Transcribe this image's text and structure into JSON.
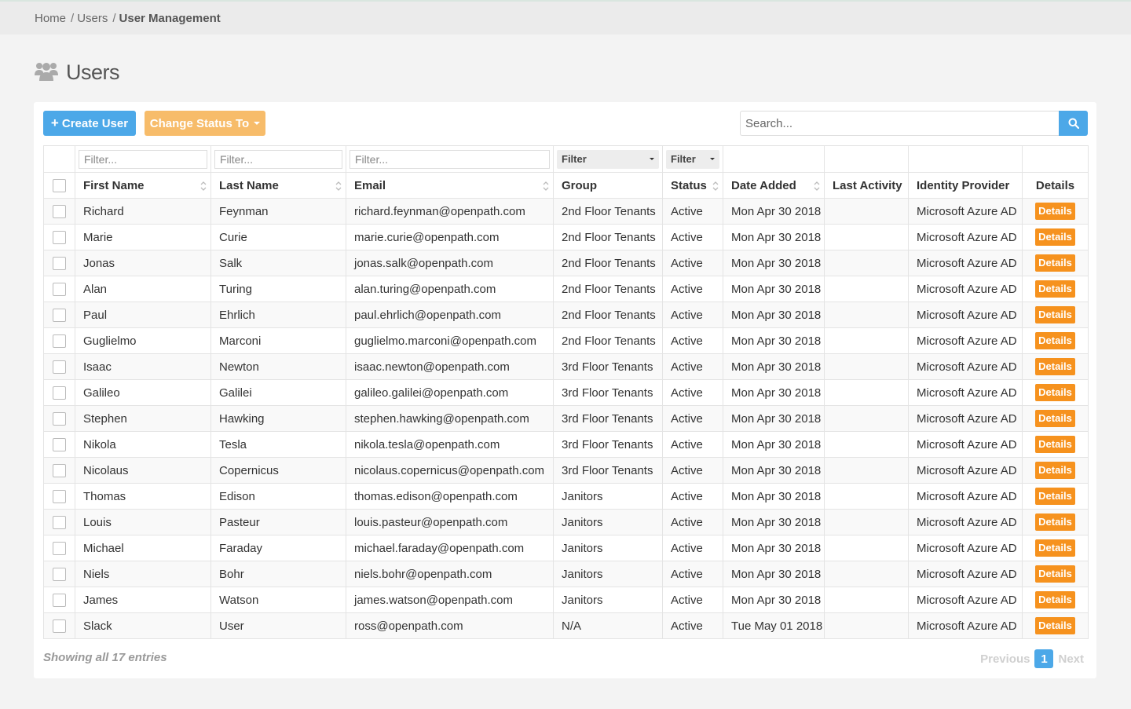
{
  "breadcrumb": {
    "home": "Home",
    "users": "Users",
    "current": "User Management"
  },
  "page": {
    "title": "Users"
  },
  "toolbar": {
    "create_label": "Create User",
    "create_icon": "+",
    "status_label": "Change Status To",
    "search_placeholder": "Search..."
  },
  "filters": {
    "text_placeholder": "Filter...",
    "select_label": "Filter"
  },
  "columns": [
    "First Name",
    "Last Name",
    "Email",
    "Group",
    "Status",
    "Date Added",
    "Last Activity",
    "Identity Provider",
    "Details"
  ],
  "details_label": "Details",
  "rows": [
    {
      "first": "Richard",
      "last": "Feynman",
      "email": "richard.feynman@openpath.com",
      "group": "2nd Floor Tenants",
      "status": "Active",
      "date": "Mon Apr 30 2018",
      "activity": "",
      "provider": "Microsoft Azure AD"
    },
    {
      "first": "Marie",
      "last": "Curie",
      "email": "marie.curie@openpath.com",
      "group": "2nd Floor Tenants",
      "status": "Active",
      "date": "Mon Apr 30 2018",
      "activity": "",
      "provider": "Microsoft Azure AD"
    },
    {
      "first": "Jonas",
      "last": "Salk",
      "email": "jonas.salk@openpath.com",
      "group": "2nd Floor Tenants",
      "status": "Active",
      "date": "Mon Apr 30 2018",
      "activity": "",
      "provider": "Microsoft Azure AD"
    },
    {
      "first": "Alan",
      "last": "Turing",
      "email": "alan.turing@openpath.com",
      "group": "2nd Floor Tenants",
      "status": "Active",
      "date": "Mon Apr 30 2018",
      "activity": "",
      "provider": "Microsoft Azure AD"
    },
    {
      "first": "Paul",
      "last": "Ehrlich",
      "email": "paul.ehrlich@openpath.com",
      "group": "2nd Floor Tenants",
      "status": "Active",
      "date": "Mon Apr 30 2018",
      "activity": "",
      "provider": "Microsoft Azure AD"
    },
    {
      "first": "Guglielmo",
      "last": "Marconi",
      "email": "guglielmo.marconi@openpath.com",
      "group": "2nd Floor Tenants",
      "status": "Active",
      "date": "Mon Apr 30 2018",
      "activity": "",
      "provider": "Microsoft Azure AD"
    },
    {
      "first": "Isaac",
      "last": "Newton",
      "email": "isaac.newton@openpath.com",
      "group": "3rd Floor Tenants",
      "status": "Active",
      "date": "Mon Apr 30 2018",
      "activity": "",
      "provider": "Microsoft Azure AD"
    },
    {
      "first": "Galileo",
      "last": "Galilei",
      "email": "galileo.galilei@openpath.com",
      "group": "3rd Floor Tenants",
      "status": "Active",
      "date": "Mon Apr 30 2018",
      "activity": "",
      "provider": "Microsoft Azure AD"
    },
    {
      "first": "Stephen",
      "last": "Hawking",
      "email": "stephen.hawking@openpath.com",
      "group": "3rd Floor Tenants",
      "status": "Active",
      "date": "Mon Apr 30 2018",
      "activity": "",
      "provider": "Microsoft Azure AD"
    },
    {
      "first": "Nikola",
      "last": "Tesla",
      "email": "nikola.tesla@openpath.com",
      "group": "3rd Floor Tenants",
      "status": "Active",
      "date": "Mon Apr 30 2018",
      "activity": "",
      "provider": "Microsoft Azure AD"
    },
    {
      "first": "Nicolaus",
      "last": "Copernicus",
      "email": "nicolaus.copernicus@openpath.com",
      "group": "3rd Floor Tenants",
      "status": "Active",
      "date": "Mon Apr 30 2018",
      "activity": "",
      "provider": "Microsoft Azure AD"
    },
    {
      "first": "Thomas",
      "last": "Edison",
      "email": "thomas.edison@openpath.com",
      "group": "Janitors",
      "status": "Active",
      "date": "Mon Apr 30 2018",
      "activity": "",
      "provider": "Microsoft Azure AD"
    },
    {
      "first": "Louis",
      "last": "Pasteur",
      "email": "louis.pasteur@openpath.com",
      "group": "Janitors",
      "status": "Active",
      "date": "Mon Apr 30 2018",
      "activity": "",
      "provider": "Microsoft Azure AD"
    },
    {
      "first": "Michael",
      "last": "Faraday",
      "email": "michael.faraday@openpath.com",
      "group": "Janitors",
      "status": "Active",
      "date": "Mon Apr 30 2018",
      "activity": "",
      "provider": "Microsoft Azure AD"
    },
    {
      "first": "Niels",
      "last": "Bohr",
      "email": "niels.bohr@openpath.com",
      "group": "Janitors",
      "status": "Active",
      "date": "Mon Apr 30 2018",
      "activity": "",
      "provider": "Microsoft Azure AD"
    },
    {
      "first": "James",
      "last": "Watson",
      "email": "james.watson@openpath.com",
      "group": "Janitors",
      "status": "Active",
      "date": "Mon Apr 30 2018",
      "activity": "",
      "provider": "Microsoft Azure AD"
    },
    {
      "first": "Slack",
      "last": "User",
      "email": "ross@openpath.com",
      "group": "N/A",
      "status": "Active",
      "date": "Tue May 01 2018",
      "activity": "",
      "provider": "Microsoft Azure AD"
    }
  ],
  "footer": {
    "info": "Showing all 17 entries"
  },
  "pagination": {
    "previous": "Previous",
    "current": "1",
    "next": "Next"
  },
  "colors": {
    "primary": "#4ca8e8",
    "warning": "#f7bc6a",
    "details": "#f6921e"
  }
}
